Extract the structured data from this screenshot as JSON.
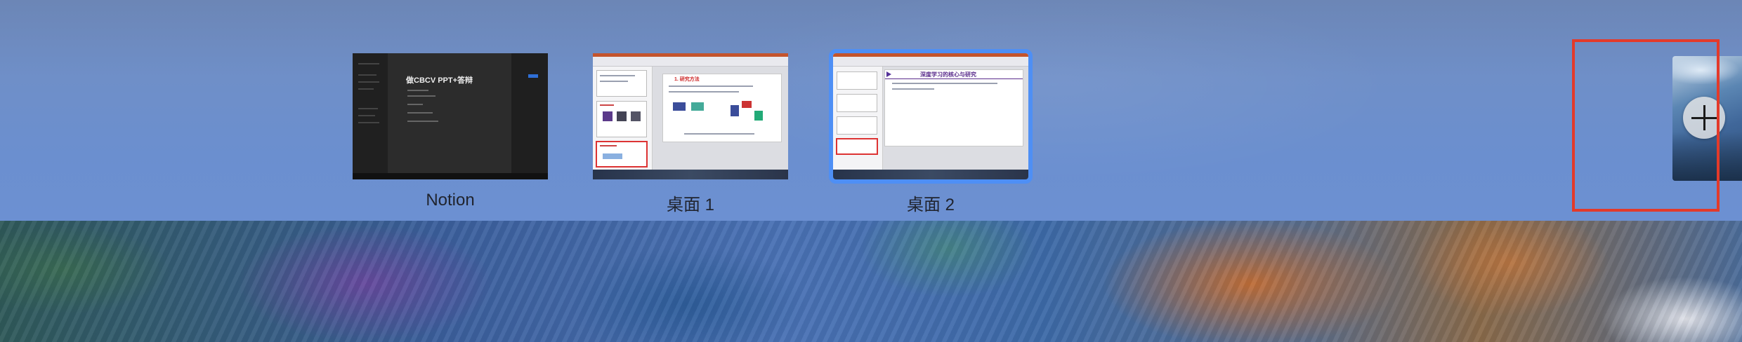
{
  "spaces": [
    {
      "label": "Notion",
      "thumb_title": "做CBCV PPT+答辩",
      "selected": false
    },
    {
      "label": "桌面 1",
      "thumb_title": "1. 研究方法",
      "selected": false
    },
    {
      "label": "桌面 2",
      "thumb_title": "深度学习的核心与研究",
      "selected": true
    }
  ],
  "add_space": {
    "icon": "plus-icon"
  },
  "colors": {
    "selection": "#4e8ff5",
    "highlight": "#e33a2a"
  }
}
